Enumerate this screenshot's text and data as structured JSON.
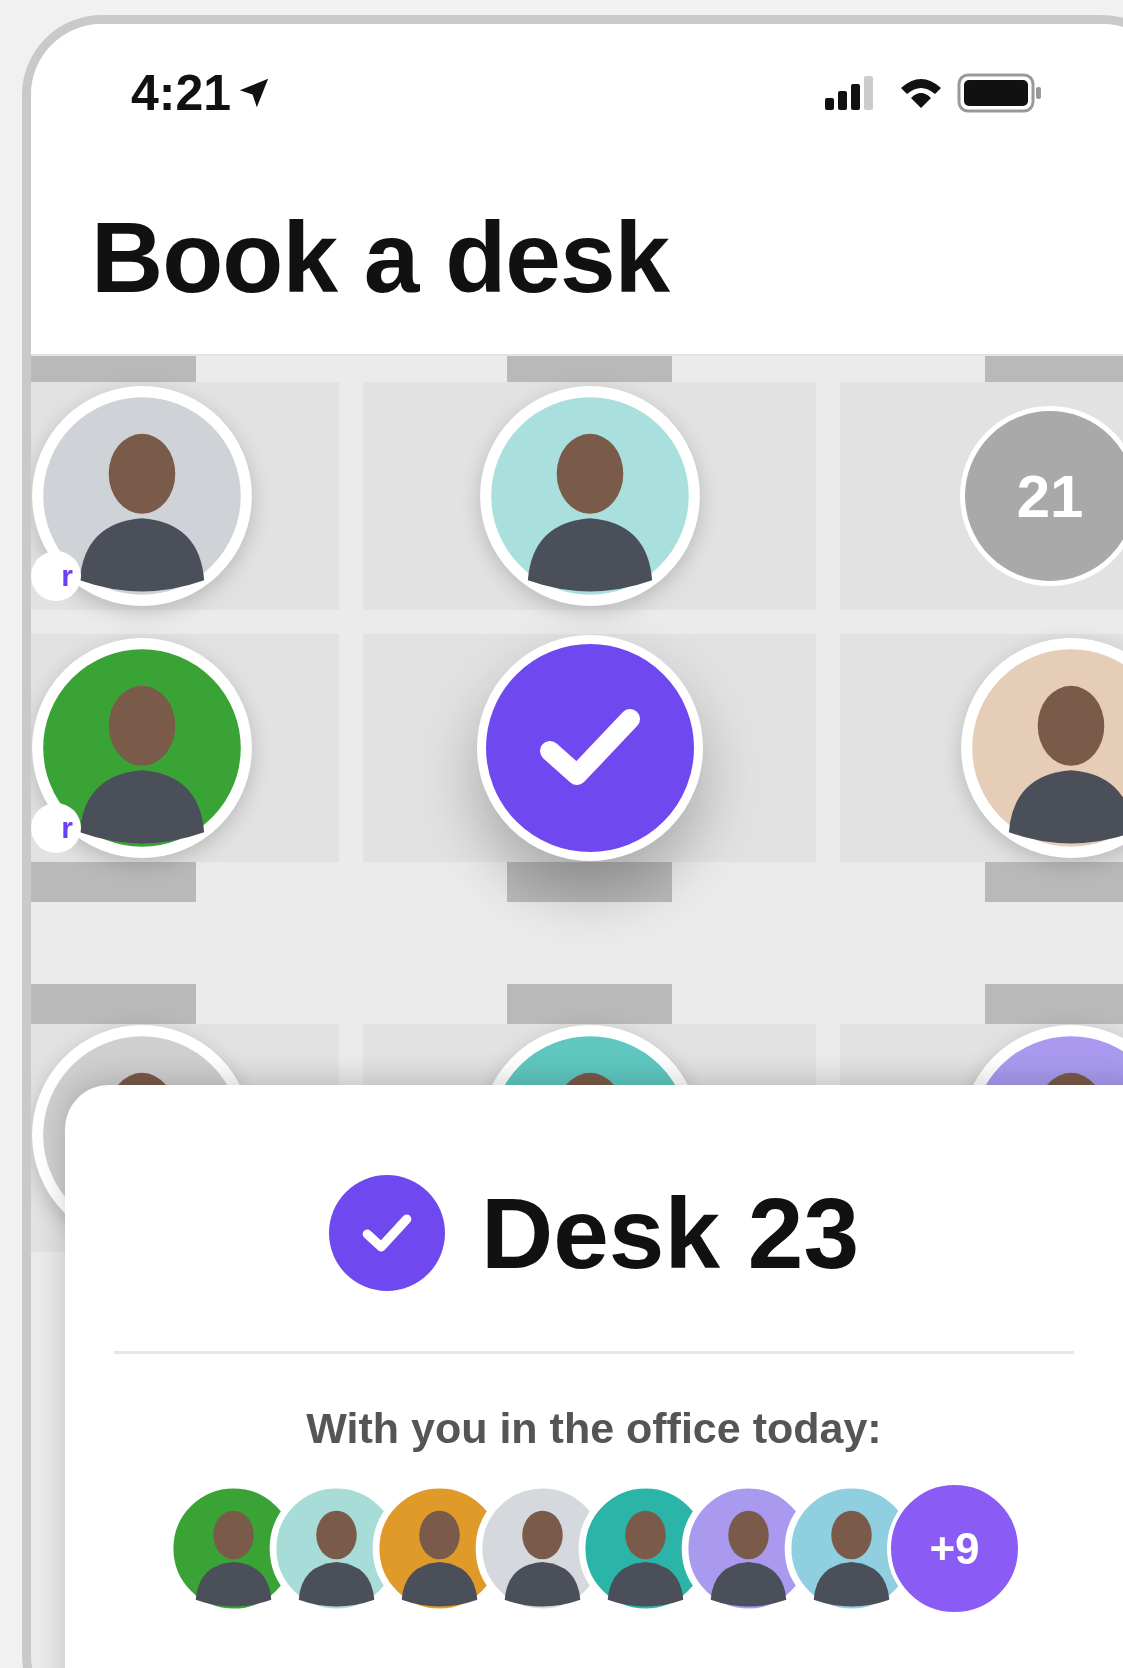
{
  "status_bar": {
    "time": "4:21"
  },
  "title": "Book a desk",
  "floor_plan": {
    "upper_desks": [
      {
        "kind": "person",
        "color": "#cfd3d8",
        "badge": "r"
      },
      {
        "kind": "person",
        "color": "#a9e0de"
      },
      {
        "kind": "number",
        "label": "21"
      },
      {
        "kind": "person",
        "color": "#3aa335",
        "badge": "r"
      },
      {
        "kind": "selected"
      },
      {
        "kind": "person",
        "color": "#e6cdb8"
      }
    ],
    "lower_desks": [
      {
        "kind": "person",
        "color": "#cfcfcf"
      },
      {
        "kind": "person",
        "color": "#5fc7c0"
      },
      {
        "kind": "person",
        "color": "#a99af0"
      }
    ]
  },
  "booking_card": {
    "desk": "Desk 23",
    "booked": true,
    "subtitle": "With you in the office today:",
    "attendees": [
      {
        "color": "#3aa335"
      },
      {
        "color": "#a8dcd9"
      },
      {
        "color": "#e09a2a"
      },
      {
        "color": "#d5d8dc"
      },
      {
        "color": "#2bb5a8"
      },
      {
        "color": "#a99af0"
      },
      {
        "color": "#8fcfe0"
      }
    ],
    "more": "+9"
  }
}
